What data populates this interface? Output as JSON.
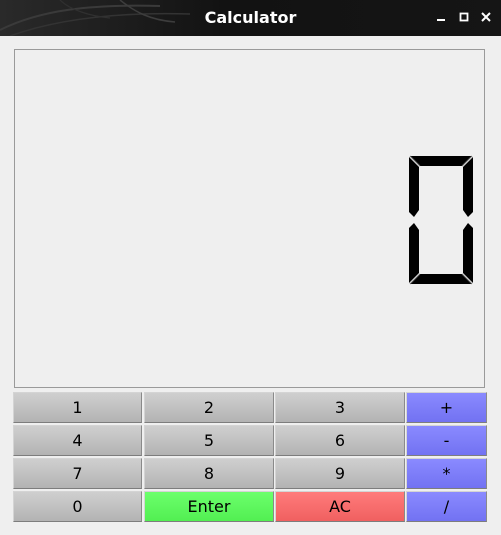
{
  "window": {
    "title": "Calculator",
    "controls": {
      "minimize_icon": "minimize-icon",
      "maximize_icon": "maximize-icon",
      "close_icon": "close-icon"
    }
  },
  "display": {
    "value": "0"
  },
  "keypad": {
    "rows": [
      [
        "1",
        "2",
        "3",
        "+"
      ],
      [
        "4",
        "5",
        "6",
        "-"
      ],
      [
        "7",
        "8",
        "9",
        "*"
      ],
      [
        "0",
        "Enter",
        "AC",
        "/"
      ]
    ]
  },
  "colors": {
    "key_gray": "#c0c0c0",
    "key_operator": "#7b7bf8",
    "key_enter": "#5cf65c",
    "key_clear": "#f86a6a",
    "titlebar": "#141414",
    "display_digit": "#000000"
  }
}
